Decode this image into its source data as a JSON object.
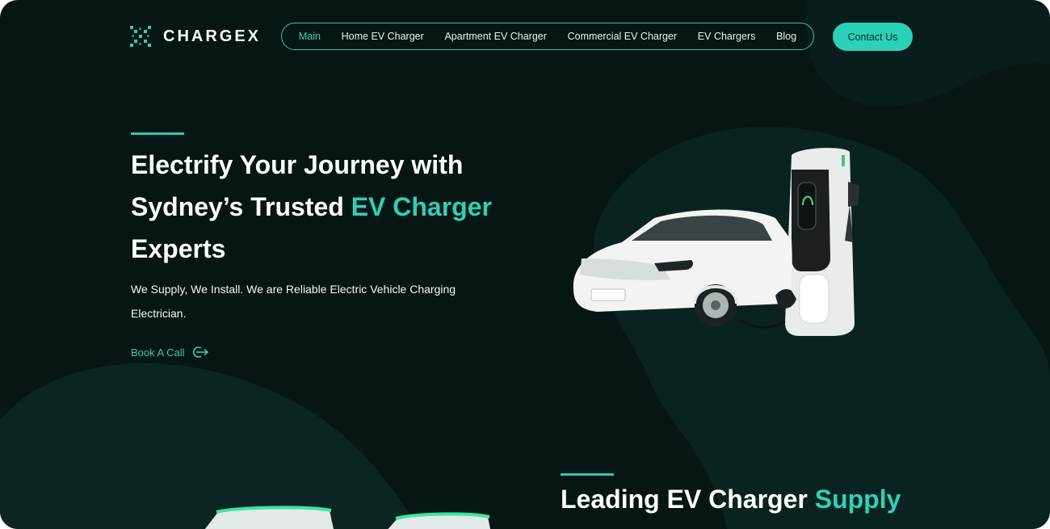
{
  "brand": {
    "name": "CHARGEX"
  },
  "nav": {
    "items": [
      {
        "label": "Main",
        "active": true
      },
      {
        "label": "Home EV Charger"
      },
      {
        "label": "Apartment EV Charger"
      },
      {
        "label": "Commercial EV Charger"
      },
      {
        "label": "EV Chargers"
      },
      {
        "label": "Blog"
      }
    ],
    "contact_label": "Contact Us"
  },
  "hero": {
    "title_line1": "Electrify Your Journey with",
    "title_line2_pre": "Sydney’s Trusted ",
    "title_line2_highlight": "EV Charger",
    "title_line3": "Experts",
    "subtitle": "We Supply, We Install. We are Reliable Electric Vehicle Charging Electrician.",
    "cta_label": "Book A Call"
  },
  "section2": {
    "title_pre": "Leading EV Charger ",
    "title_highlight": "Supply"
  },
  "colors": {
    "background": "#061614",
    "accent": "#2fd0b6",
    "button": "#2ad1b7"
  },
  "icons": {
    "logo": "chargex-logo-icon",
    "cta": "arrow-circle-icon"
  }
}
